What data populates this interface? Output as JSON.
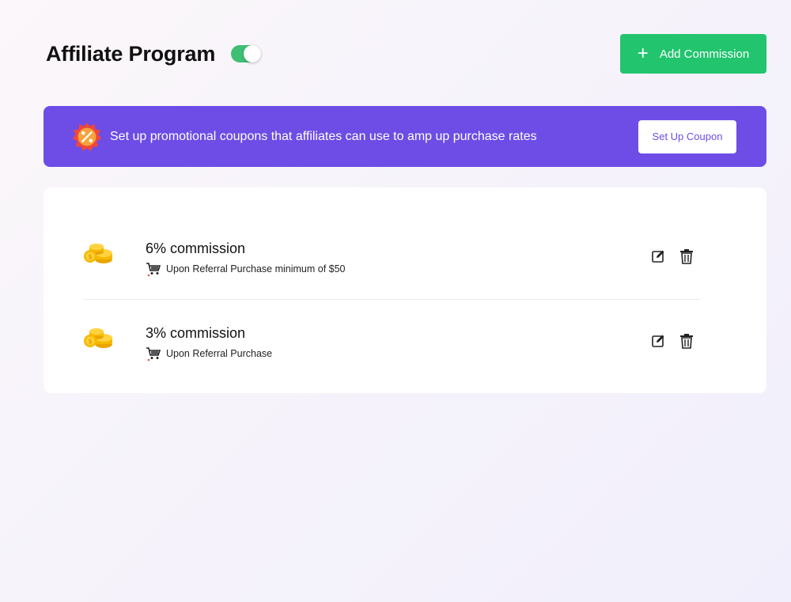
{
  "header": {
    "title": "Affiliate Program",
    "toggle_on": true,
    "add_button_label": "Add Commission",
    "accent_color": "#22c46e"
  },
  "banner": {
    "text": "Set up promotional coupons that affiliates can use to amp up purchase rates",
    "button_label": "Set Up Coupon",
    "background_color": "#6d4de6",
    "icon": "discount-badge-icon"
  },
  "commissions": [
    {
      "title": "6% commission",
      "subtitle": "Upon Referral Purchase minimum of $50",
      "icon": "coins-icon"
    },
    {
      "title": "3% commission",
      "subtitle": "Upon Referral Purchase",
      "icon": "coins-icon"
    }
  ]
}
